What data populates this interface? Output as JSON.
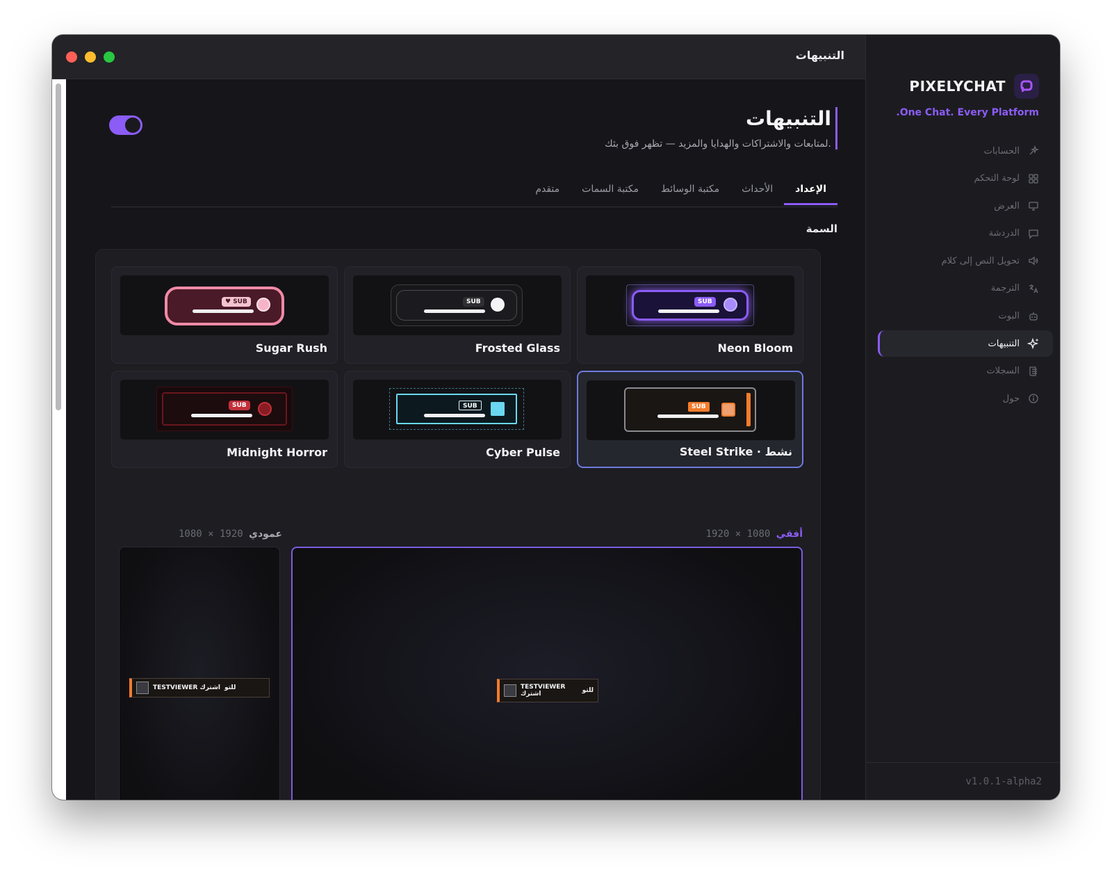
{
  "window": {
    "title": "التنبيهات",
    "traffic_lights": [
      "#ff5f57",
      "#febc2e",
      "#28c840"
    ]
  },
  "sidebar": {
    "brand": "PIXELYCHAT",
    "tagline": ".One Chat. Every Platform",
    "accent": "#8b5cf6",
    "items": [
      {
        "label": "الحسابات",
        "icon": "sparkle-plug-icon"
      },
      {
        "label": "لوحة التحكم",
        "icon": "grid-icon"
      },
      {
        "label": "العرض",
        "icon": "monitor-icon"
      },
      {
        "label": "الدردشة",
        "icon": "chat-bubble-icon"
      },
      {
        "label": "تحويل النص إلى كلام",
        "icon": "speaker-icon"
      },
      {
        "label": "الترجمة",
        "icon": "translate-icon"
      },
      {
        "label": "البوت",
        "icon": "bot-icon"
      },
      {
        "label": "التنبيهات",
        "icon": "sparkles-icon",
        "active": true
      },
      {
        "label": "السجلات",
        "icon": "log-list-icon"
      },
      {
        "label": "حول",
        "icon": "info-icon"
      }
    ],
    "version": "v1.0.1-alpha2"
  },
  "main": {
    "title": "التنبيهات",
    "subtitle": "لمتابعات والاشتراكات والهدايا والمزيد — تظهر فوق بثك.",
    "enabled": true,
    "tabs": [
      "الإعداد",
      "الأحداث",
      "مكتبة الوسائط",
      "مكتبة السمات",
      "متقدم"
    ],
    "active_tab": "الإعداد",
    "section_label": "السمة",
    "themes": [
      {
        "name": "Neon Bloom",
        "badge": "SUB",
        "accent": "#8b5cf6"
      },
      {
        "name": "Frosted Glass",
        "badge": "SUB",
        "accent": "#ffffff"
      },
      {
        "name": "Sugar Rush",
        "badge": "♥ SUB",
        "accent": "#f08aa6"
      },
      {
        "name": "Steel Strike · نشط",
        "badge": "SUB",
        "accent": "#f47c2c",
        "selected": true
      },
      {
        "name": "Cyber Pulse",
        "badge": "SUB",
        "accent": "#6ad8f0"
      },
      {
        "name": "Midnight Horror",
        "badge": "SUB",
        "accent": "#c2303a"
      }
    ],
    "preview": {
      "horizontal_label": "أفقي",
      "horizontal_size": "1920 × 1080",
      "vertical_label": "عمودي",
      "vertical_size": "1080 × 1920",
      "alert_text": "TESTVIEWER اشترك",
      "alert_suffix": "للتو"
    }
  }
}
